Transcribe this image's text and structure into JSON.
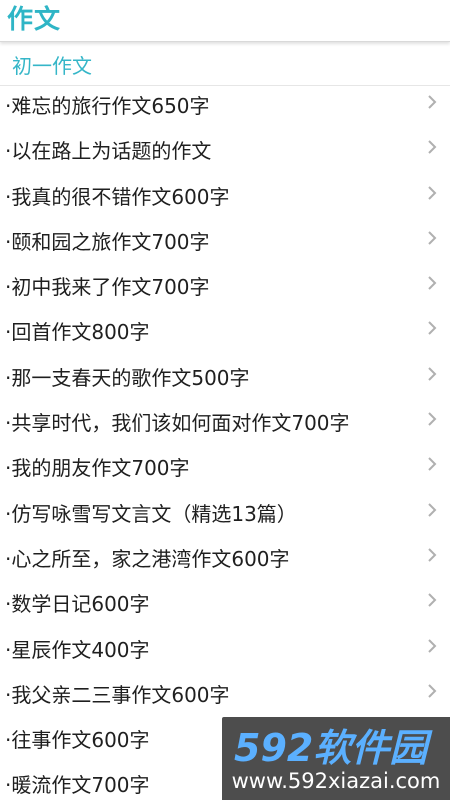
{
  "header": {
    "title": "作文"
  },
  "category": {
    "label": "初一作文"
  },
  "items": [
    {
      "label": "·难忘的旅行作文650字"
    },
    {
      "label": "·以在路上为话题的作文"
    },
    {
      "label": "·我真的很不错作文600字"
    },
    {
      "label": "·颐和园之旅作文700字"
    },
    {
      "label": "·初中我来了作文700字"
    },
    {
      "label": "·回首作文800字"
    },
    {
      "label": "·那一支春天的歌作文500字"
    },
    {
      "label": "·共享时代，我们该如何面对作文700字"
    },
    {
      "label": "·我的朋友作文700字"
    },
    {
      "label": "·仿写咏雪写文言文（精选13篇）"
    },
    {
      "label": "·心之所至，家之港湾作文600字"
    },
    {
      "label": "·数学日记600字"
    },
    {
      "label": "·星辰作文400字"
    },
    {
      "label": "·我父亲二三事作文600字"
    },
    {
      "label": "·往事作文600字"
    },
    {
      "label": "·暖流作文700字"
    }
  ],
  "watermark": {
    "brand": "592软件园",
    "url": "www.592xiazai.com"
  },
  "icons": {
    "chevron": "chevron-right-icon"
  },
  "colors": {
    "accent": "#2fb5c6",
    "text": "#1f1f1f",
    "chevron": "#b0b0b0"
  }
}
